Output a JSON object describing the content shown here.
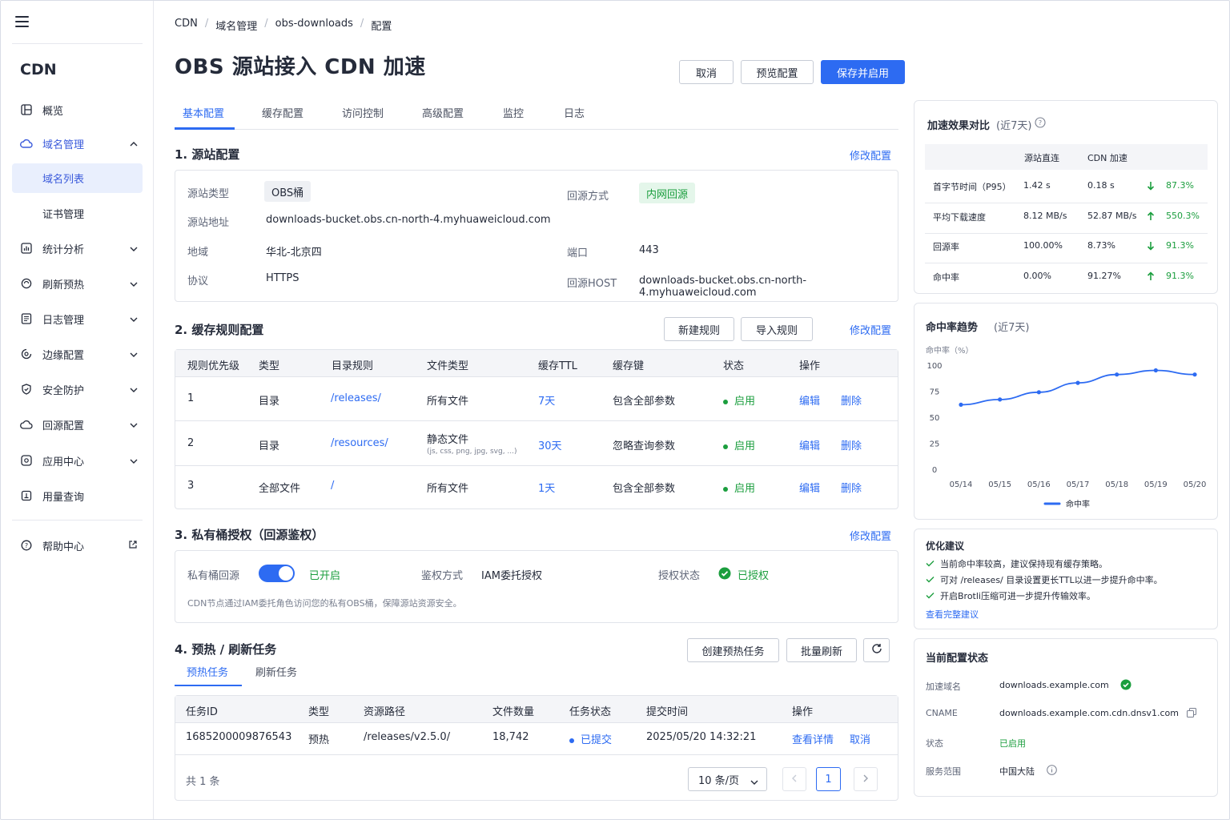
{
  "sidebar": {
    "title": "CDN",
    "items": [
      {
        "label": "概览"
      },
      {
        "label": "域名管理"
      },
      {
        "label": "域名列表"
      },
      {
        "label": "证书管理"
      },
      {
        "label": "统计分析"
      },
      {
        "label": "刷新预热"
      },
      {
        "label": "日志管理"
      },
      {
        "label": "边缘配置"
      },
      {
        "label": "安全防护"
      },
      {
        "label": "回源配置"
      },
      {
        "label": "应用中心"
      },
      {
        "label": "用量查询"
      }
    ],
    "help": "帮助中心"
  },
  "breadcrumb": [
    "CDN",
    "域名管理",
    "obs-downloads",
    "配置"
  ],
  "page_title": "OBS 源站接入 CDN 加速",
  "actions": {
    "cancel": "取消",
    "preview": "预览配置",
    "save": "保存并启用"
  },
  "tabs": [
    "基本配置",
    "缓存配置",
    "访问控制",
    "高级配置",
    "监控",
    "日志"
  ],
  "origin": {
    "heading": "1. 源站配置",
    "edit": "修改配置",
    "type_label": "源站类型",
    "type": "OBS桶",
    "mode_label": "回源方式",
    "mode": "内网回源",
    "addr_label": "源站地址",
    "addr": "downloads-bucket.obs.cn-north-4.myhuaweicloud.com",
    "region_label": "地域",
    "region": "华北-北京四",
    "port_label": "端口",
    "port": "443",
    "proto_label": "协议",
    "proto": "HTTPS",
    "host_label": "回源HOST",
    "host": "downloads-bucket.obs.cn-north-4.myhuaweicloud.com"
  },
  "cache": {
    "heading": "2. 缓存规则配置",
    "new": "新建规则",
    "import": "导入规则",
    "edit": "修改配置",
    "columns": [
      "规则优先级",
      "类型",
      "目录规则",
      "文件类型",
      "缓存TTL",
      "缓存键",
      "状态",
      "操作"
    ],
    "rows": [
      {
        "p": "1",
        "type": "目录",
        "dir": "/releases/",
        "ftype": "所有文件",
        "fsub": "",
        "ttl": "7天",
        "key": "包含全部参数",
        "status": "启用",
        "op1": "编辑",
        "op2": "删除"
      },
      {
        "p": "2",
        "type": "目录",
        "dir": "/resources/",
        "ftype": "静态文件",
        "fsub": "(js, css, png, jpg, svg, ...)",
        "ttl": "30天",
        "key": "忽略查询参数",
        "status": "启用",
        "op1": "编辑",
        "op2": "删除"
      },
      {
        "p": "3",
        "type": "全部文件",
        "dir": "/",
        "ftype": "所有文件",
        "fsub": "",
        "ttl": "1天",
        "key": "包含全部参数",
        "status": "启用",
        "op1": "编辑",
        "op2": "删除"
      }
    ]
  },
  "auth": {
    "heading": "3. 私有桶授权（回源鉴权）",
    "edit": "修改配置",
    "private_label": "私有桶回源",
    "private_state": "已开启",
    "method_label": "鉴权方式",
    "method": "IAM委托授权",
    "status_label": "授权状态",
    "status": "已授权",
    "note": "CDN节点通过IAM委托角色访问您的私有OBS桶，保障源站资源安全。"
  },
  "tasks": {
    "heading": "4. 预热 / 刷新任务",
    "create": "创建预热任务",
    "batch": "批量刷新",
    "subtabs": [
      "预热任务",
      "刷新任务"
    ],
    "columns": [
      "任务ID",
      "类型",
      "资源路径",
      "文件数量",
      "任务状态",
      "提交时间",
      "操作"
    ],
    "rows": [
      {
        "id": "1685200009876543",
        "type": "预热",
        "path": "/releases/v2.5.0/",
        "count": "18,742",
        "status": "已提交",
        "time": "2025/05/20 14:32:21",
        "op1": "查看详情",
        "op2": "取消"
      }
    ],
    "total": "共 1 条",
    "page_size": "10 条/页",
    "page": "1"
  },
  "compare": {
    "title": "加速效果对比",
    "period": "(近7天)",
    "cols": [
      "源站直连",
      "CDN 加速"
    ],
    "rows": [
      {
        "m": "首字节时间（P95）",
        "a": "1.42 s",
        "b": "0.18 s",
        "d": "87.3%",
        "dir": "down"
      },
      {
        "m": "平均下载速度",
        "a": "8.12 MB/s",
        "b": "52.87 MB/s",
        "d": "550.3%",
        "dir": "up"
      },
      {
        "m": "回源率",
        "a": "100.00%",
        "b": "8.73%",
        "d": "91.3%",
        "dir": "down"
      },
      {
        "m": "命中率",
        "a": "0.00%",
        "b": "91.27%",
        "d": "91.3%",
        "dir": "up"
      }
    ]
  },
  "chart_data": {
    "type": "line",
    "title": "命中率趋势",
    "subtitle": "(近7天)",
    "ylabel": "命中率（%）",
    "categories": [
      "05/14",
      "05/15",
      "05/16",
      "05/17",
      "05/18",
      "05/19",
      "05/20"
    ],
    "series": [
      {
        "name": "命中率",
        "values": [
          62,
          67,
          74,
          83,
          91,
          95,
          91
        ]
      }
    ],
    "ylim": [
      0,
      100
    ],
    "yticks": [
      0,
      25,
      50,
      75,
      100
    ],
    "color": "#2d6bf2",
    "legend": "bottom"
  },
  "tips": {
    "title": "优化建议",
    "items": [
      "当前命中率较高，建议保持现有缓存策略。",
      "可对 /releases/ 目录设置更长TTL以进一步提升命中率。",
      "开启Brotli压缩可进一步提升传输效率。"
    ],
    "more": "查看完整建议"
  },
  "status": {
    "title": "当前配置状态",
    "domain_label": "加速域名",
    "domain": "downloads.example.com",
    "cname_label": "CNAME",
    "cname": "downloads.example.com.cdn.dnsv1.com",
    "state_label": "状态",
    "state": "已启用",
    "scope_label": "服务范围",
    "scope": "中国大陆"
  }
}
